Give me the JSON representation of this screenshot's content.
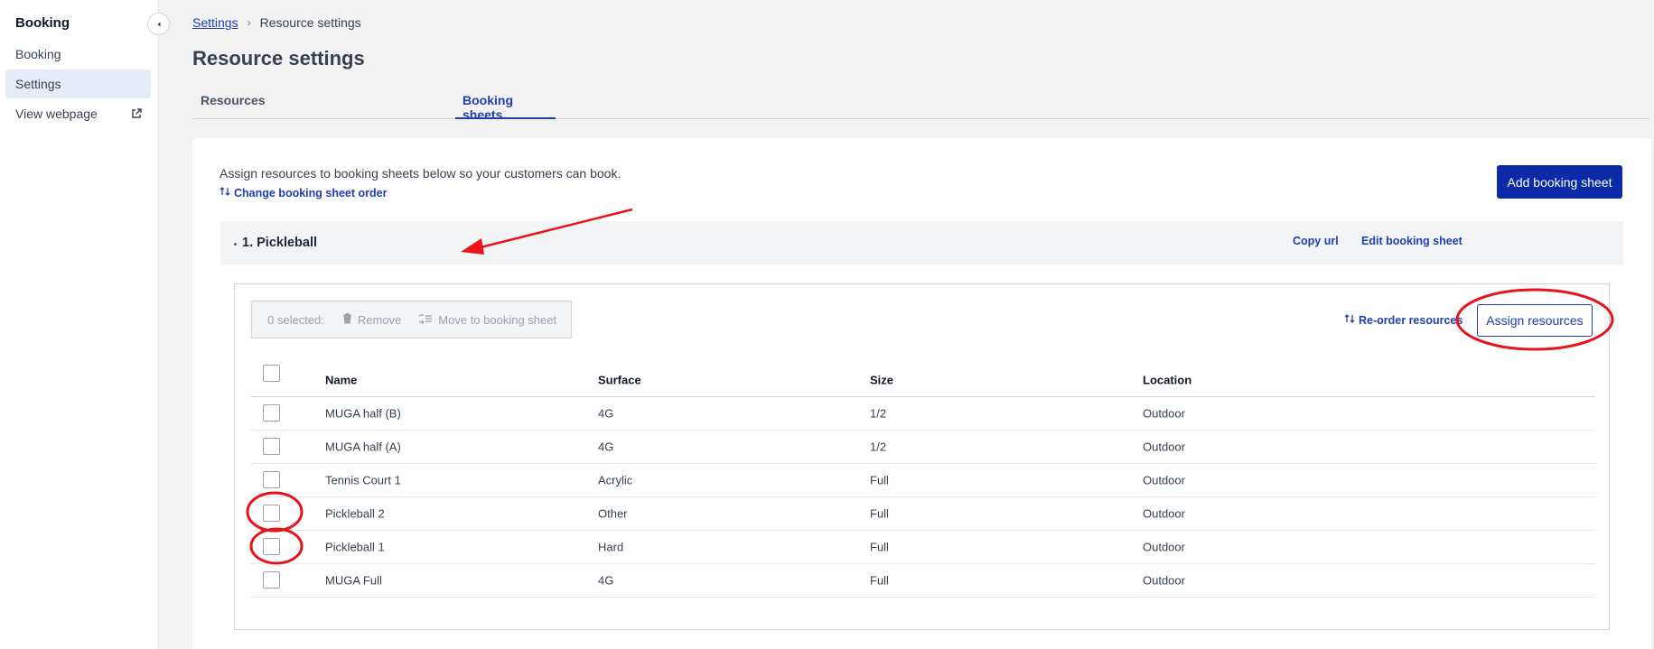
{
  "sidebar": {
    "title": "Booking",
    "items": [
      {
        "label": "Booking"
      },
      {
        "label": "Settings"
      },
      {
        "label": "View webpage"
      }
    ]
  },
  "breadcrumb": {
    "parent": "Settings",
    "current": "Resource settings"
  },
  "page": {
    "title": "Resource settings"
  },
  "tabs": [
    {
      "label": "Resources"
    },
    {
      "label": "Booking sheets"
    }
  ],
  "card": {
    "intro": "Assign resources to booking sheets below so your customers can book.",
    "change_order_label": "Change booking sheet order",
    "add_sheet_label": "Add booking sheet"
  },
  "sheet": {
    "name": "1. Pickleball",
    "copy_url_label": "Copy url",
    "edit_label": "Edit booking sheet"
  },
  "toolbar": {
    "selected_label": "0 selected:",
    "remove_label": "Remove",
    "move_label": "Move to booking sheet",
    "reorder_label": "Re-order resources",
    "assign_label": "Assign resources"
  },
  "table": {
    "headers": [
      "Name",
      "Surface",
      "Size",
      "Location"
    ],
    "rows": [
      [
        "MUGA half (B)",
        "4G",
        "1/2",
        "Outdoor"
      ],
      [
        "MUGA half (A)",
        "4G",
        "1/2",
        "Outdoor"
      ],
      [
        "Tennis Court 1",
        "Acrylic",
        "Full",
        "Outdoor"
      ],
      [
        "Pickleball 2",
        "Other",
        "Full",
        "Outdoor"
      ],
      [
        "Pickleball 1",
        "Hard",
        "Full",
        "Outdoor"
      ],
      [
        "MUGA Full",
        "4G",
        "Full",
        "Outdoor"
      ]
    ]
  },
  "colors": {
    "accent": "#1f3fb3",
    "primary_button": "#0b2aa8",
    "annotation": "#e8141a"
  }
}
